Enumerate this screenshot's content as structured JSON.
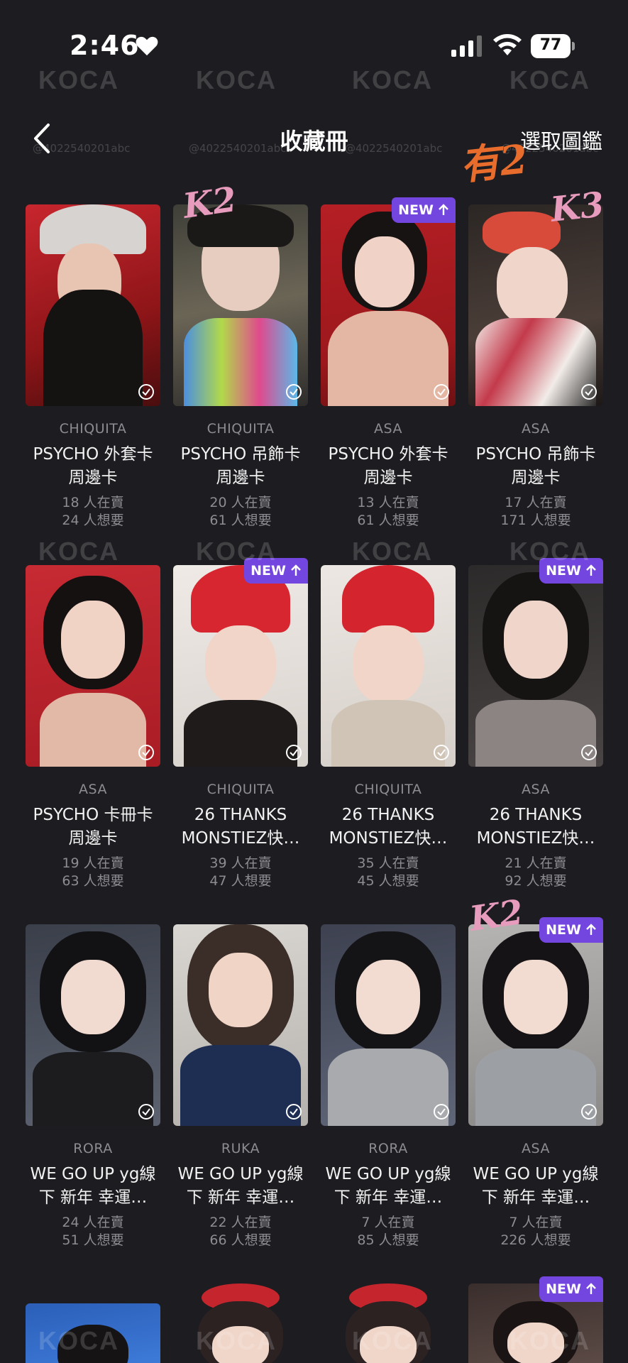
{
  "status_bar": {
    "time": "2:46",
    "battery": "77"
  },
  "nav": {
    "title": "收藏冊",
    "action": "選取圖鑑"
  },
  "watermark": {
    "brand": "KOCA",
    "tag": "@4022540201abc"
  },
  "annotations": {
    "k2_first": "K2",
    "has2": "有2",
    "k3": "K3",
    "k2_row3": "K2"
  },
  "badge_new": "NEW",
  "cards": [
    {
      "member": "CHIQUITA",
      "title1": "PSYCHO 外套卡",
      "title2": "周邊卡",
      "sell": "18 人在賣",
      "want": "24 人想要"
    },
    {
      "member": "CHIQUITA",
      "title1": "PSYCHO 吊飾卡",
      "title2": "周邊卡",
      "sell": "20 人在賣",
      "want": "61 人想要"
    },
    {
      "member": "ASA",
      "title1": "PSYCHO 外套卡",
      "title2": "周邊卡",
      "sell": "13 人在賣",
      "want": "61 人想要"
    },
    {
      "member": "ASA",
      "title1": "PSYCHO 吊飾卡",
      "title2": "周邊卡",
      "sell": "17 人在賣",
      "want": "171 人想要"
    },
    {
      "member": "ASA",
      "title1": "PSYCHO 卡冊卡",
      "title2": "周邊卡",
      "sell": "19 人在賣",
      "want": "63 人想要"
    },
    {
      "member": "CHIQUITA",
      "title1": "26 THANKS",
      "title2": "MONSTIEZ快…",
      "sell": "39 人在賣",
      "want": "47 人想要"
    },
    {
      "member": "CHIQUITA",
      "title1": "26 THANKS",
      "title2": "MONSTIEZ快…",
      "sell": "35 人在賣",
      "want": "45 人想要"
    },
    {
      "member": "ASA",
      "title1": "26 THANKS",
      "title2": "MONSTIEZ快…",
      "sell": "21 人在賣",
      "want": "92 人想要"
    },
    {
      "member": "RORA",
      "title1": "WE GO UP yg線",
      "title2": "下 新年 幸運…",
      "sell": "24 人在賣",
      "want": "51 人想要"
    },
    {
      "member": "RUKA",
      "title1": "WE GO UP yg線",
      "title2": "下 新年 幸運…",
      "sell": "22 人在賣",
      "want": "66 人想要"
    },
    {
      "member": "RORA",
      "title1": "WE GO UP yg線",
      "title2": "下 新年 幸運…",
      "sell": "7 人在賣",
      "want": "85 人想要"
    },
    {
      "member": "ASA",
      "title1": "WE GO UP yg線",
      "title2": "下 新年 幸運…",
      "sell": "7 人在賣",
      "want": "226 人想要"
    }
  ],
  "colors": {
    "background": "#1d1c20",
    "badge": "#7446e0",
    "muted_text": "#8d8c92"
  }
}
